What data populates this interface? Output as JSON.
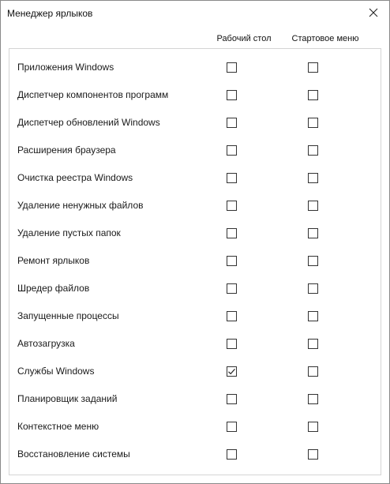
{
  "window": {
    "title": "Менеджер ярлыков"
  },
  "columns": {
    "desktop": "Рабочий стол",
    "start_menu": "Стартовое меню"
  },
  "rows": [
    {
      "label": "Приложения Windows",
      "desktop": false,
      "start_menu": false
    },
    {
      "label": "Диспетчер компонентов программ",
      "desktop": false,
      "start_menu": false
    },
    {
      "label": "Диспетчер обновлений Windows",
      "desktop": false,
      "start_menu": false
    },
    {
      "label": "Расширения браузера",
      "desktop": false,
      "start_menu": false
    },
    {
      "label": "Очистка реестра Windows",
      "desktop": false,
      "start_menu": false
    },
    {
      "label": "Удаление ненужных файлов",
      "desktop": false,
      "start_menu": false
    },
    {
      "label": "Удаление пустых папок",
      "desktop": false,
      "start_menu": false
    },
    {
      "label": "Ремонт ярлыков",
      "desktop": false,
      "start_menu": false
    },
    {
      "label": "Шредер файлов",
      "desktop": false,
      "start_menu": false
    },
    {
      "label": "Запущенные процессы",
      "desktop": false,
      "start_menu": false
    },
    {
      "label": "Автозагрузка",
      "desktop": false,
      "start_menu": false
    },
    {
      "label": "Службы Windows",
      "desktop": true,
      "start_menu": false
    },
    {
      "label": "Планировщик заданий",
      "desktop": false,
      "start_menu": false
    },
    {
      "label": "Контекстное меню",
      "desktop": false,
      "start_menu": false
    },
    {
      "label": "Восстановление системы",
      "desktop": false,
      "start_menu": false
    }
  ],
  "icons": {
    "close": "close-icon",
    "check": "checkmark-icon"
  }
}
